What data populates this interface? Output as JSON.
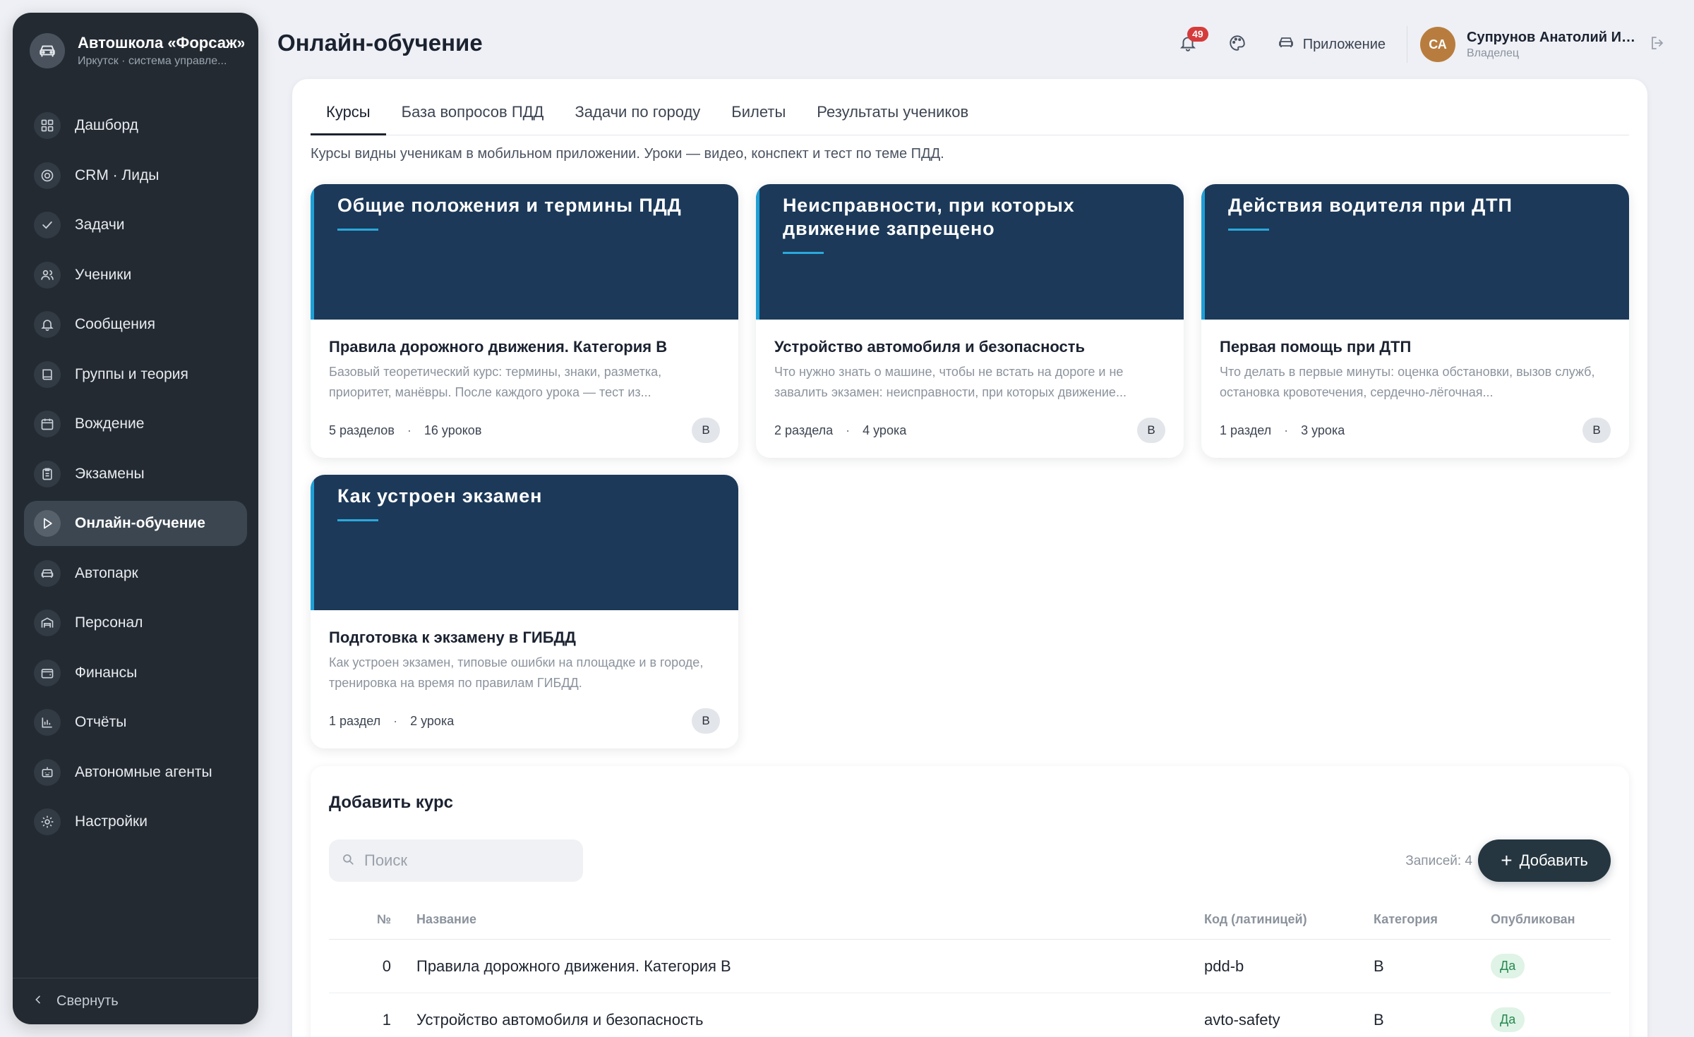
{
  "brand": {
    "title": "Автошкола «Форсаж»",
    "subtitle": "Иркутск · система управле..."
  },
  "sidebar": {
    "items": [
      {
        "label": "Дашборд",
        "icon": "dashboard-icon"
      },
      {
        "label": "CRM · Лиды",
        "icon": "target-icon"
      },
      {
        "label": "Задачи",
        "icon": "check-icon"
      },
      {
        "label": "Ученики",
        "icon": "users-icon"
      },
      {
        "label": "Сообщения",
        "icon": "bell-icon"
      },
      {
        "label": "Группы и теория",
        "icon": "book-icon"
      },
      {
        "label": "Вождение",
        "icon": "calendar-icon"
      },
      {
        "label": "Экзамены",
        "icon": "clipboard-icon"
      },
      {
        "label": "Онлайн-обучение",
        "icon": "play-icon",
        "active": true
      },
      {
        "label": "Автопарк",
        "icon": "car-icon"
      },
      {
        "label": "Персонал",
        "icon": "garage-icon"
      },
      {
        "label": "Финансы",
        "icon": "wallet-icon"
      },
      {
        "label": "Отчёты",
        "icon": "bar-chart-icon"
      },
      {
        "label": "Автономные агенты",
        "icon": "robot-icon"
      },
      {
        "label": "Настройки",
        "icon": "gear-icon"
      }
    ],
    "collapse_label": "Свернуть"
  },
  "header": {
    "title": "Онлайн-обучение",
    "notifications_count": "49",
    "app_label": "Приложение",
    "user_initials": "СА",
    "user_name": "Супрунов Анатолий Ив...",
    "user_role": "Владелец"
  },
  "tabs": [
    {
      "label": "Курсы",
      "active": true
    },
    {
      "label": "База вопросов ПДД"
    },
    {
      "label": "Задачи по городу"
    },
    {
      "label": "Билеты"
    },
    {
      "label": "Результаты учеников"
    }
  ],
  "description": "Курсы видны ученикам в мобильном приложении. Уроки — видео, конспект и тест по теме ПДД.",
  "courses": [
    {
      "cover": "Общие положения и термины ПДД",
      "title": "Правила дорожного движения. Категория B",
      "desc": "Базовый теоретический курс: термины, знаки, разметка, приоритет, манёвры. После каждого урока — тест из...",
      "sections": "5 разделов",
      "lessons": "16 уроков",
      "category": "B"
    },
    {
      "cover": "Неисправности, при которых движение запрещено",
      "title": "Устройство автомобиля и безопасность",
      "desc": "Что нужно знать о машине, чтобы не встать на дороге и не завалить экзамен: неисправности, при которых движение...",
      "sections": "2 раздела",
      "lessons": "4 урока",
      "category": "B"
    },
    {
      "cover": "Действия водителя при ДТП",
      "title": "Первая помощь при ДТП",
      "desc": "Что делать в первые минуты: оценка обстановки, вызов служб, остановка кровотечения, сердечно-лёгочная...",
      "sections": "1 раздел",
      "lessons": "3 урока",
      "category": "B"
    },
    {
      "cover": "Как устроен экзамен",
      "title": "Подготовка к экзамену в ГИБДД",
      "desc": "Как устроен экзамен, типовые ошибки на площадке и в городе, тренировка на время по правилам ГИБДД.",
      "sections": "1 раздел",
      "lessons": "2 урока",
      "category": "B"
    }
  ],
  "add_course": {
    "title": "Добавить курс",
    "search_placeholder": "Поиск",
    "records_label": "Записей: 4",
    "add_button": "Добавить",
    "columns": {
      "num": "№",
      "name": "Название",
      "code": "Код (латиницей)",
      "category": "Категория",
      "published": "Опубликован"
    },
    "rows": [
      {
        "num": "0",
        "name": "Правила дорожного движения. Категория B",
        "code": "pdd-b",
        "category": "B",
        "published": "Да"
      },
      {
        "num": "1",
        "name": "Устройство автомобиля и безопасность",
        "code": "avto-safety",
        "category": "B",
        "published": "Да"
      }
    ]
  },
  "colors": {
    "sidebar_bg": "#232a32",
    "cover_bg": "#1c3959",
    "cover_accent": "#1ea0d6",
    "badge_red": "#d63b3b",
    "avatar_bg": "#b87d3e",
    "published_green": "#268a4f"
  }
}
